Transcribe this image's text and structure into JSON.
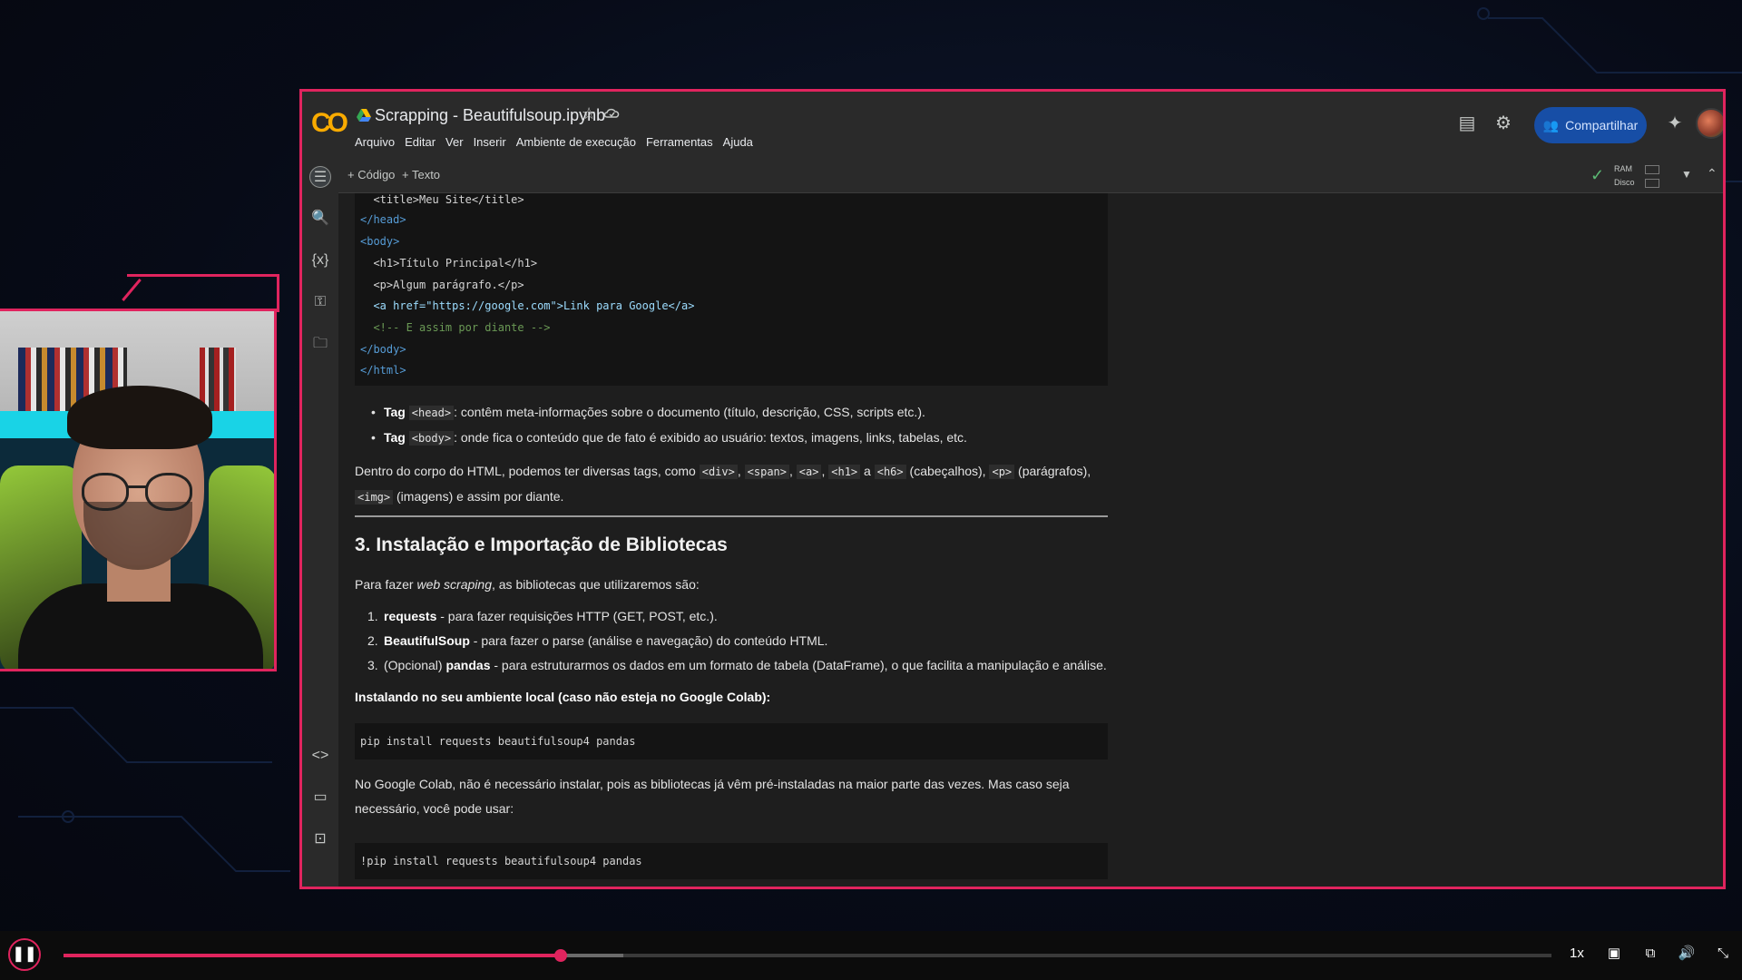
{
  "notebook": {
    "title": "Scrapping - Beautifulsoup.ipynb",
    "menu": [
      "Arquivo",
      "Editar",
      "Ver",
      "Inserir",
      "Ambiente de execução",
      "Ferramentas",
      "Ajuda"
    ],
    "share_label": "Compartilhar",
    "add_code_label": "+ Código",
    "add_text_label": "+ Texto",
    "ram_label": "RAM",
    "disk_label": "Disco"
  },
  "icons": {
    "comments": "comment-icon",
    "settings": "gear-icon",
    "gemini": "sparkle-icon"
  },
  "content": {
    "code1": [
      "  <title>Meu Site</title>",
      "</head>",
      "<body>",
      "  <h1>Título Principal</h1>",
      "  <p>Algum parágrafo.</p>",
      "  <a href=\"https://google.com\">Link para Google</a>",
      "  <!-- E assim por diante -->",
      "</body>",
      "</html>"
    ],
    "bullet_head_label": "Tag",
    "bullet_head_code": "<head>",
    "bullet_head_text": ": contêm meta-informações sobre o documento (título, descrição, CSS, scripts etc.).",
    "bullet_body_label": "Tag",
    "bullet_body_code": "<body>",
    "bullet_body_text": ": onde fica o conteúdo que de fato é exibido ao usuário: textos, imagens, links, tabelas, etc.",
    "para1_a": "Dentro do corpo do HTML, podemos ter diversas tags, como",
    "para1_div": "<div>",
    "para1_span": "<span>",
    "para1_acode": "<a>",
    "para1_h1": "<h1>",
    "para1_a2": "a",
    "para1_h6": "<h6>",
    "para1_b": "(cabeçalhos),",
    "para1_p": "<p>",
    "para1_c": "(parágrafos),",
    "para1_img": "<img>",
    "para1_d": "(imagens) e assim por diante.",
    "heading3": "3. Instalação e Importação de Bibliotecas",
    "para2_a": "Para fazer",
    "para2_em": "web scraping",
    "para2_b": ", as bibliotecas que utilizaremos são:",
    "list": [
      {
        "n": "1.",
        "b": "requests",
        "t": " - para fazer requisições HTTP (GET, POST, etc.)."
      },
      {
        "n": "2.",
        "b": "BeautifulSoup",
        "t": " - para fazer o parse (análise e navegação) do conteúdo HTML."
      },
      {
        "n": "3.",
        "pre": "(Opcional) ",
        "b": "pandas",
        "t": " - para estruturarmos os dados em um formato de tabela (DataFrame), o que facilita a manipulação e análise."
      }
    ],
    "install_local": "Instalando no seu ambiente local (caso não esteja no Google Colab):",
    "code2": "pip install requests beautifulsoup4 pandas",
    "para3": "No Google Colab, não é necessário instalar, pois as bibliotecas já vêm pré-instaladas na maior parte das vezes. Mas caso seja necessário, você pode usar:",
    "code3": "!pip install requests beautifulsoup4 pandas"
  },
  "player": {
    "speed": "1x",
    "progress": 0.334,
    "buffered": 0.376
  },
  "colors": {
    "accent": "#e0245e",
    "share_bg": "#174ea6"
  }
}
